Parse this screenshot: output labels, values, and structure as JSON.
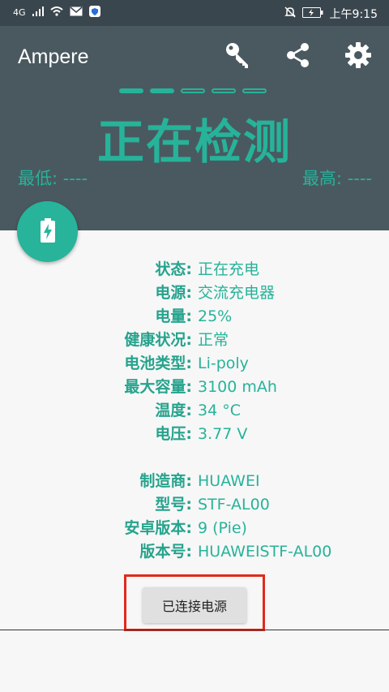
{
  "statusbar": {
    "network": "4G",
    "time_prefix": "上午",
    "time": "9:15",
    "icons": [
      "signal-icon",
      "wifi-icon",
      "mail-icon",
      "shield-icon",
      "mute-icon",
      "battery-charging-icon"
    ]
  },
  "toolbar": {
    "title": "Ampere",
    "actions": [
      "key-icon",
      "share-icon",
      "settings-icon"
    ]
  },
  "progress_dots": {
    "total": 5,
    "active": 2
  },
  "header": {
    "status": "正在检测",
    "min": "最低: ----",
    "max": "最高: ----"
  },
  "info": {
    "status_label": "状态:",
    "status_value": "正在充电",
    "source_label": "电源:",
    "source_value": "交流充电器",
    "level_label": "电量:",
    "level_value": "25%",
    "health_label": "健康状况:",
    "health_value": "正常",
    "tech_label": "电池类型:",
    "tech_value": "Li-poly",
    "capacity_label": "最大容量:",
    "capacity_value": "3100 mAh",
    "temp_label": "温度:",
    "temp_value": "34 °C",
    "voltage_label": "电压:",
    "voltage_value": "3.77 V",
    "maker_label": "制造商:",
    "maker_value": "HUAWEI",
    "model_label": "型号:",
    "model_value": "STF-AL00",
    "android_label": "安卓版本:",
    "android_value": "9 (Pie)",
    "build_label": "版本号:",
    "build_value": "HUAWEISTF-AL00"
  },
  "connect_button": "已连接电源",
  "colors": {
    "accent": "#26b39a",
    "header": "#4a5960",
    "highlight": "#e02a1d"
  }
}
